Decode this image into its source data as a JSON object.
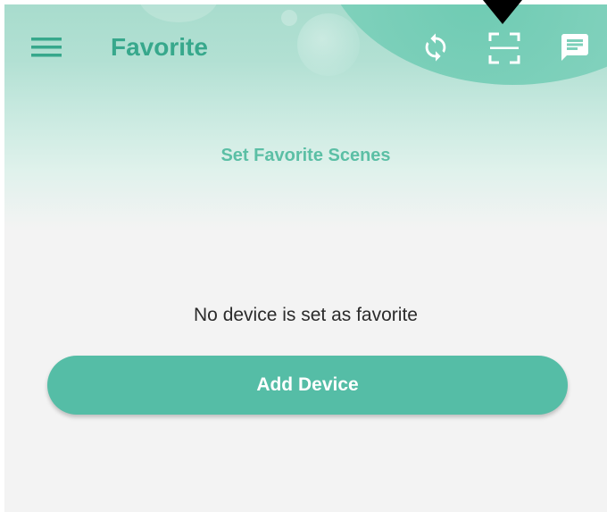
{
  "header": {
    "title": "Favorite",
    "subtitle": "Set Favorite Scenes",
    "accent_color": "#37a88c",
    "icons": [
      "menu-icon",
      "sync-icon",
      "scan-icon",
      "message-icon"
    ]
  },
  "main": {
    "empty_message": "No device is set as favorite",
    "add_button_label": "Add Device",
    "button_color": "#55bda6"
  }
}
